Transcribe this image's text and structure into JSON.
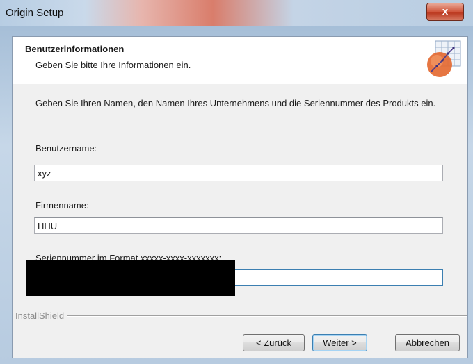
{
  "window": {
    "title": "Origin Setup",
    "close_glyph": "x"
  },
  "header": {
    "title": "Benutzerinformationen",
    "subtitle": "Geben Sie bitte Ihre Informationen ein.",
    "logo_icon": "origin-graph-logo-icon"
  },
  "body": {
    "intro": "Geben Sie Ihren Namen, den Namen Ihres Unternehmens und die Seriennummer des Produkts ein.",
    "username_label": "Benutzername:",
    "username_value": "xyz",
    "company_label": "Firmenname:",
    "company_value": "HHU",
    "serial_label": "Seriennummer im Format xxxxx-xxxx-xxxxxxx:",
    "serial_value": ""
  },
  "footer": {
    "brand": "InstallShield",
    "back_label": "< Zurück",
    "next_label": "Weiter >",
    "cancel_label": "Abbrechen"
  },
  "colors": {
    "accent": "#3c7fb1",
    "close": "#c8462c",
    "redaction": "#000000"
  }
}
